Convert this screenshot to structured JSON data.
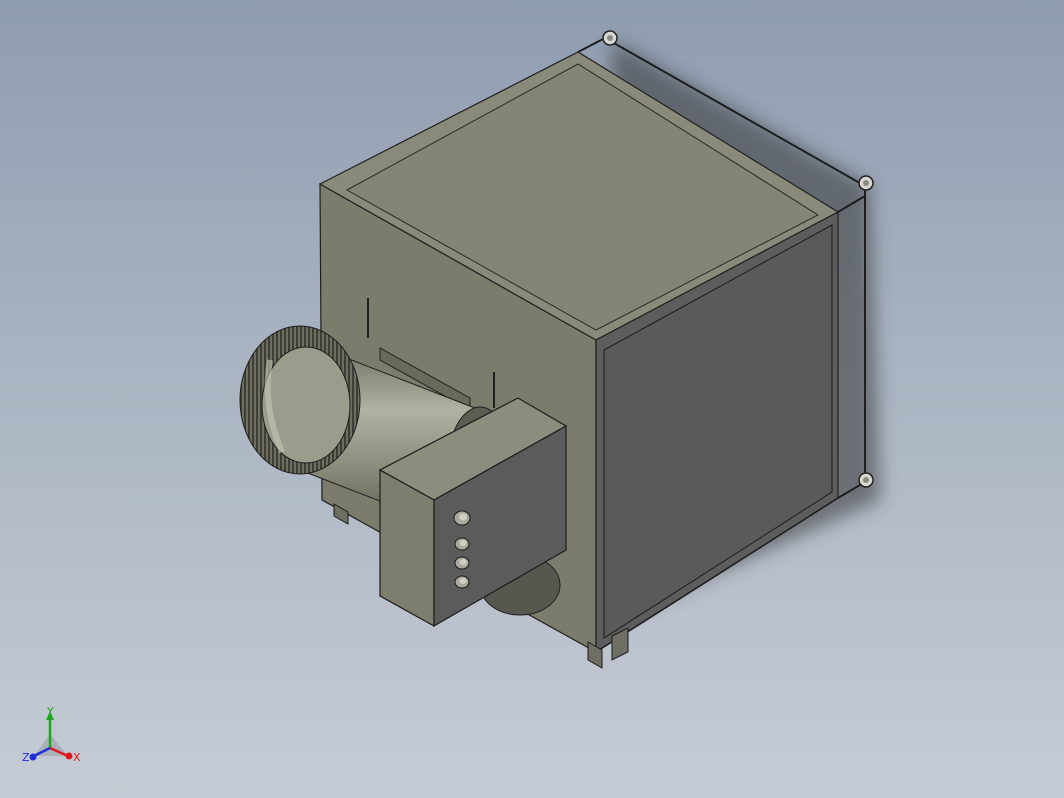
{
  "scene": {
    "model_name": "",
    "background_top": "#8f9db0",
    "background_bottom": "#c6ccd5",
    "body_color": "#7d7d6e",
    "front_face_color": "#5d5d5d",
    "shadow_color": "#3a3a3a"
  },
  "triad": {
    "x_label": "X",
    "y_label": "Y",
    "z_label": "Z",
    "x_color": "#e01818",
    "y_color": "#1fa81f",
    "z_color": "#1c2fd8"
  },
  "icons": {
    "triad": "axis-triad-icon"
  }
}
